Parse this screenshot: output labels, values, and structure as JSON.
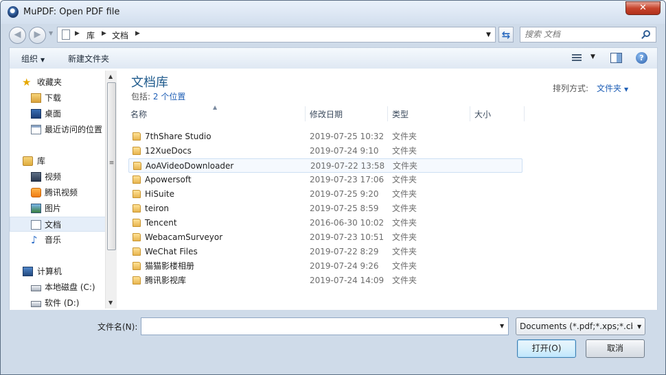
{
  "window": {
    "title": "MuPDF: Open PDF file",
    "close_label": "✕"
  },
  "address_bar": {
    "crumbs": [
      "库",
      "文档"
    ]
  },
  "search": {
    "placeholder": "搜索 文档"
  },
  "toolbar": {
    "organize_label": "组织",
    "new_folder_label": "新建文件夹"
  },
  "sidebar": {
    "items": [
      {
        "label": "收藏夹",
        "icon": "star-icon"
      },
      {
        "label": "下载",
        "icon": "download-folder-icon"
      },
      {
        "label": "桌面",
        "icon": "desktop-icon"
      },
      {
        "label": "最近访问的位置",
        "icon": "recent-places-icon"
      },
      {
        "label": "库",
        "icon": "library-icon"
      },
      {
        "label": "视频",
        "icon": "video-icon"
      },
      {
        "label": "腾讯视频",
        "icon": "tencent-video-icon"
      },
      {
        "label": "图片",
        "icon": "pictures-icon"
      },
      {
        "label": "文档",
        "icon": "documents-icon",
        "selected": true
      },
      {
        "label": "音乐",
        "icon": "music-icon"
      },
      {
        "label": "计算机",
        "icon": "computer-icon"
      },
      {
        "label": "本地磁盘 (C:)",
        "icon": "disk-icon"
      },
      {
        "label": "软件 (D:)",
        "icon": "disk-icon"
      }
    ]
  },
  "library": {
    "title": "文档库",
    "includes_label": "包括:",
    "locations_link": "2 个位置",
    "arrange_label": "排列方式:",
    "arrange_value": "文件夹"
  },
  "columns": {
    "name": "名称",
    "date": "修改日期",
    "type": "类型",
    "size": "大小"
  },
  "files": [
    {
      "name": "7thShare Studio",
      "date": "2019-07-25 10:32",
      "type": "文件夹"
    },
    {
      "name": "12XueDocs",
      "date": "2019-07-24 9:10",
      "type": "文件夹"
    },
    {
      "name": "AoAVideoDownloader",
      "date": "2019-07-22 13:58",
      "type": "文件夹"
    },
    {
      "name": "Apowersoft",
      "date": "2019-07-23 17:06",
      "type": "文件夹"
    },
    {
      "name": "HiSuite",
      "date": "2019-07-25 9:20",
      "type": "文件夹"
    },
    {
      "name": "teiron",
      "date": "2019-07-25 8:59",
      "type": "文件夹"
    },
    {
      "name": "Tencent",
      "date": "2016-06-30 10:02",
      "type": "文件夹"
    },
    {
      "name": "WebacamSurveyor",
      "date": "2019-07-23 10:51",
      "type": "文件夹"
    },
    {
      "name": "WeChat Files",
      "date": "2019-07-22 8:29",
      "type": "文件夹"
    },
    {
      "name": "猫猫影楼相册",
      "date": "2019-07-24 9:26",
      "type": "文件夹"
    },
    {
      "name": "腾讯影视库",
      "date": "2019-07-24 14:09",
      "type": "文件夹"
    }
  ],
  "filename": {
    "label": "文件名(N):",
    "value": ""
  },
  "filter": {
    "selected": "Documents (*.pdf;*.xps;*.cbz;"
  },
  "buttons": {
    "open": "打开(O)",
    "cancel": "取消"
  }
}
